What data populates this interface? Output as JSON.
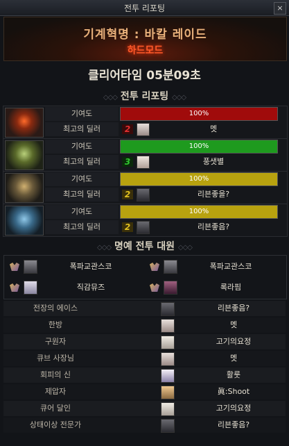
{
  "window": {
    "title": "전투 리포팅",
    "close": "×"
  },
  "raid": {
    "title": "기계혁명 : 바칼 레이드",
    "mode": "하드모드"
  },
  "clear": {
    "time": "클리어타임  05분09초"
  },
  "sections": {
    "report": "전투 리포팅",
    "honor": "명예 전투 대원"
  },
  "deco": "◇◇◇",
  "rows": [
    {
      "contrib_label": "기여도",
      "contrib_value": "100%",
      "contrib_fraction": 1.0,
      "bar_color": "#a00b0b",
      "dealer_label": "최고의 딜러",
      "rank": "2",
      "rank_color": "#e03030",
      "dealer_name": "멧"
    },
    {
      "contrib_label": "기여도",
      "contrib_value": "100%",
      "contrib_fraction": 1.0,
      "bar_color": "#1e9a1e",
      "dealer_label": "최고의 딜러",
      "rank": "3",
      "rank_color": "#30c830",
      "dealer_name": "풍샛별"
    },
    {
      "contrib_label": "기여도",
      "contrib_value": "100%",
      "contrib_fraction": 1.0,
      "bar_color": "#b8a20f",
      "dealer_label": "최고의 딜러",
      "rank": "2",
      "rank_color": "#e0c020",
      "dealer_name": "리븐좋을?"
    },
    {
      "contrib_label": "기여도",
      "contrib_value": "100%",
      "contrib_fraction": 1.0,
      "bar_color": "#b8a20f",
      "dealer_label": "최고의 딜러",
      "rank": "2",
      "rank_color": "#e0c020",
      "dealer_name": "리븐좋음?"
    }
  ],
  "honor": [
    {
      "name": "폭파교관스코"
    },
    {
      "name": "폭파교관스코"
    },
    {
      "name": "직감뮤즈"
    },
    {
      "name": "록라핌"
    }
  ],
  "awards": [
    {
      "label": "전장의 에이스",
      "name": "리븐좋음?"
    },
    {
      "label": "한방",
      "name": "멧"
    },
    {
      "label": "구원자",
      "name": "고기의요정"
    },
    {
      "label": "큐브 사장님",
      "name": "멧"
    },
    {
      "label": "회피의 신",
      "name": "활룻"
    },
    {
      "label": "제압자",
      "name": "眞:Shoot"
    },
    {
      "label": "큐어 달인",
      "name": "고기의요정"
    },
    {
      "label": "상태이상 전문가",
      "name": "리븐좋음?"
    }
  ]
}
